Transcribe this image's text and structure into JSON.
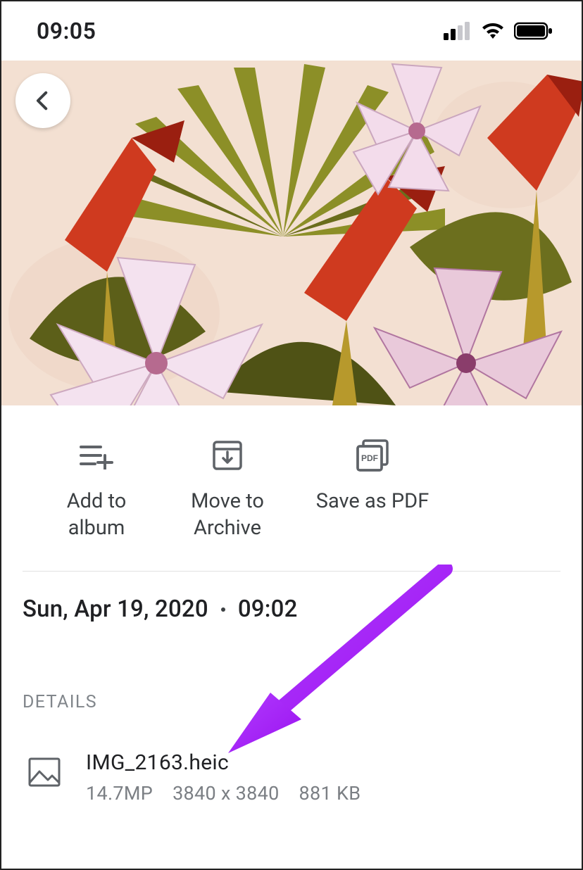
{
  "status": {
    "time": "09:05"
  },
  "actions": {
    "add_to_album": "Add to album",
    "move_to_archive": "Move to Archive",
    "save_as_pdf": "Save as PDF"
  },
  "details": {
    "date": "Sun, Apr 19, 2020",
    "time": "09:02",
    "section_label": "DETAILS",
    "file_name": "IMG_2163.heic",
    "megapixels": "14.7MP",
    "dimensions": "3840 x 3840",
    "file_size": "881 KB"
  },
  "colors": {
    "annotation": "#a020f0"
  }
}
